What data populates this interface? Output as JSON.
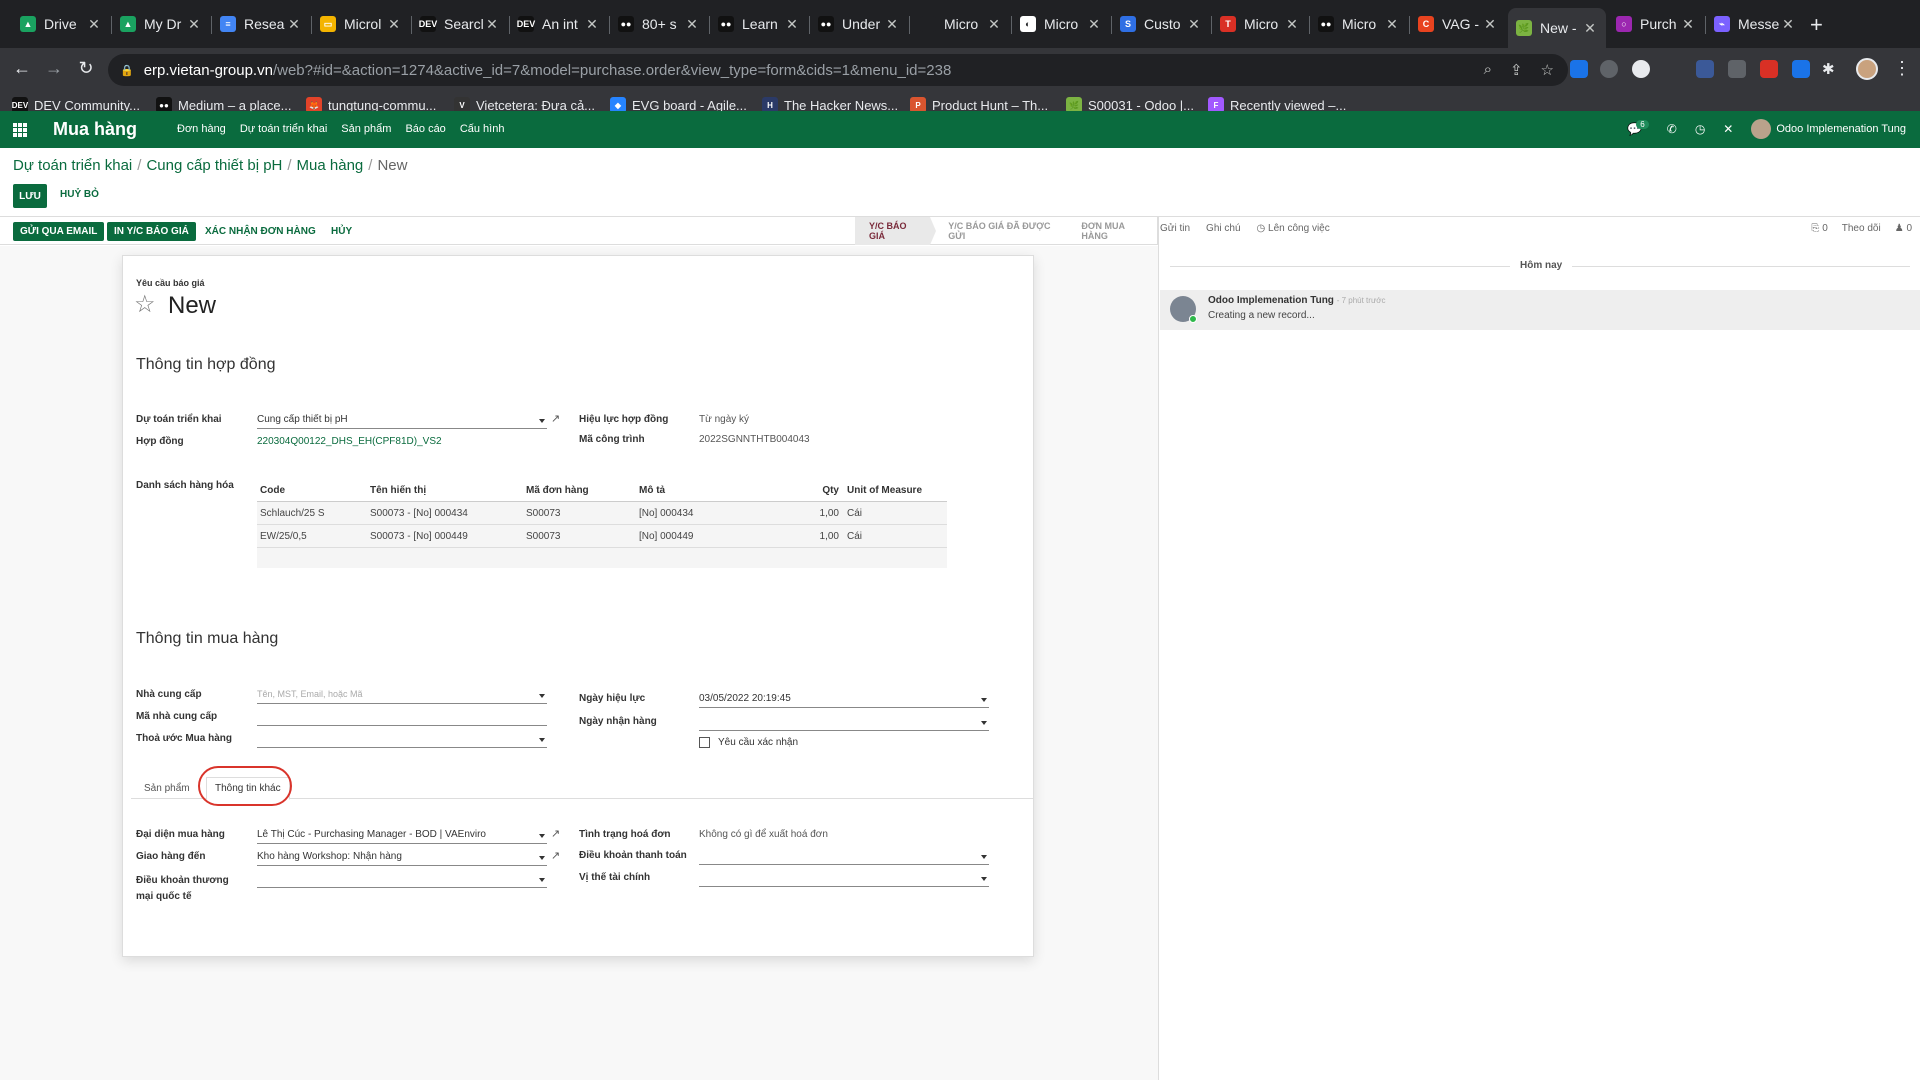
{
  "browser": {
    "tabs": [
      {
        "title": "Drive",
        "color": "#1aa260",
        "glyph": "▲"
      },
      {
        "title": "My Dr",
        "color": "#1aa260",
        "glyph": "▲"
      },
      {
        "title": "Resea",
        "color": "#4285f4",
        "glyph": "≡"
      },
      {
        "title": "Microl",
        "color": "#f4b400",
        "glyph": "▭"
      },
      {
        "title": "Searcl",
        "color": "#111111",
        "glyph": "DEV"
      },
      {
        "title": "An int",
        "color": "#111111",
        "glyph": "DEV"
      },
      {
        "title": "80+ s",
        "color": "#111111",
        "glyph": "●●"
      },
      {
        "title": "Learn",
        "color": "#111111",
        "glyph": "●●"
      },
      {
        "title": "Under",
        "color": "#111111",
        "glyph": "●●"
      },
      {
        "title": "Micro",
        "color": "#202124",
        "glyph": ""
      },
      {
        "title": "Micro",
        "color": "#ffffff",
        "glyph": "◐"
      },
      {
        "title": "Custo",
        "color": "#2f6fe4",
        "glyph": "S"
      },
      {
        "title": "Micro",
        "color": "#d93025",
        "glyph": "T"
      },
      {
        "title": "Micro",
        "color": "#111111",
        "glyph": "●●"
      },
      {
        "title": "VAG -",
        "color": "#e8431f",
        "glyph": "C"
      },
      {
        "title": "New -",
        "color": "#7cb342",
        "glyph": "🌿"
      },
      {
        "title": "Purch",
        "color": "#9c27b0",
        "glyph": "○"
      },
      {
        "title": "Messe",
        "color": "#7b61ff",
        "glyph": "⌁"
      }
    ],
    "url_host": "erp.vietan-group.vn",
    "url_path": "/web?#id=&action=1274&active_id=7&model=purchase.order&view_type=form&cids=1&menu_id=238",
    "bookmarks": [
      {
        "label": "DEV Community...",
        "color": "#111111",
        "glyph": "DEV"
      },
      {
        "label": "Medium – a place...",
        "color": "#111111",
        "glyph": "●●"
      },
      {
        "label": "tungtung-commu...",
        "color": "#e24329",
        "glyph": "🦊"
      },
      {
        "label": "Vietcetera: Đưa cả...",
        "color": "#333333",
        "glyph": "V"
      },
      {
        "label": "EVG board - Agile...",
        "color": "#2684ff",
        "glyph": "◆"
      },
      {
        "label": "The Hacker News...",
        "color": "#2b3a67",
        "glyph": "H"
      },
      {
        "label": "Product Hunt – Th...",
        "color": "#da552f",
        "glyph": "P"
      },
      {
        "label": "S00031 - Odoo |...",
        "color": "#7cb342",
        "glyph": "🌿"
      },
      {
        "label": "Recently viewed –...",
        "color": "#a259ff",
        "glyph": "F"
      }
    ]
  },
  "navbar": {
    "brand": "Mua hàng",
    "menu": [
      "Đơn hàng",
      "Dự toán triển khai",
      "Sản phẩm",
      "Báo cáo",
      "Cấu hình"
    ],
    "chat_count": "6",
    "user": "Odoo Implemenation Tung"
  },
  "breadcrumb": {
    "items": [
      "Dự toán triển khai",
      "Cung cấp thiết bị pH",
      "Mua hàng"
    ],
    "current": "New"
  },
  "actions": {
    "save": "LƯU",
    "discard": "HUỶ BỎ"
  },
  "statusbar": {
    "buttons": [
      "GỬI QUA EMAIL",
      "IN Y/C BÁO GIÁ",
      "XÁC NHẬN ĐƠN HÀNG",
      "HỦY"
    ],
    "stages": [
      "Y/C BÁO GIÁ",
      "Y/C BÁO GIÁ ĐÃ ĐƯỢC GỬI",
      "ĐƠN MUA HÀNG"
    ],
    "current_stage": "Y/C BÁO GIÁ"
  },
  "form": {
    "subtitle": "Yêu cầu báo giá",
    "title": "New",
    "section_contract": "Thông tin hợp đồng",
    "du_toan_label": "Dự toán triển khai",
    "du_toan_value": "Cung cấp thiết bị pH",
    "hop_dong_label": "Hợp đồng",
    "hop_dong_value": "220304Q00122_DHS_EH(CPF81D)_VS2",
    "hieu_luc_label": "Hiệu lực hợp đồng",
    "hieu_luc_value": "Từ ngày ký",
    "ma_cong_trinh_label": "Mã công trình",
    "ma_cong_trinh_value": "2022SGNNTHTB004043",
    "goods_label": "Danh sách hàng hóa",
    "table": {
      "headers": [
        "Code",
        "Tên hiển thị",
        "Mã đơn hàng",
        "Mô tả",
        "Qty",
        "Unit of Measure"
      ],
      "rows": [
        [
          "Schlauch/25 S",
          "S00073 - [No] 000434",
          "S00073",
          "[No] 000434",
          "1,00",
          "Cái"
        ],
        [
          "EW/25/0,5",
          "S00073 - [No] 000449",
          "S00073",
          "[No] 000449",
          "1,00",
          "Cái"
        ]
      ]
    },
    "section_purchase": "Thông tin mua hàng",
    "vendor_label": "Nhà cung cấp",
    "vendor_placeholder": "Tên, MST, Email, hoặc Mã",
    "vendor_code_label": "Mã nhà cung cấp",
    "agreement_label": "Thoả ước Mua hàng",
    "date_effective_label": "Ngày hiệu lực",
    "date_effective_value": "03/05/2022 20:19:45",
    "date_receive_label": "Ngày nhận hàng",
    "require_confirm_label": "Yêu cầu xác nhận",
    "tabs": [
      "Sản phẩm",
      "Thông tin khác"
    ],
    "active_tab": "Thông tin khác",
    "rep_label": "Đại diện mua hàng",
    "rep_value": "Lê Thị Cúc - Purchasing Manager - BOD | VAEnviro",
    "deliver_label": "Giao hàng đến",
    "deliver_value": "Kho hàng Workshop: Nhận hàng",
    "incoterm_label_1": "Điều khoản thương",
    "incoterm_label_2": "mại quốc tế",
    "invoice_status_label": "Tình trạng hoá đơn",
    "invoice_status_value": "Không có gì để xuất hoá đơn",
    "payment_terms_label": "Điều khoản thanh toán",
    "fiscal_position_label": "Vị thế tài chính"
  },
  "chatter": {
    "send_message": "Gửi tin",
    "log_note": "Ghi chú",
    "schedule_activity": "Lên công việc",
    "attachments": "0",
    "follow": "Theo dõi",
    "followers": "0",
    "today": "Hôm nay",
    "author": "Odoo Implemenation Tung",
    "time": "- 7 phút trước",
    "body": "Creating a new record..."
  }
}
